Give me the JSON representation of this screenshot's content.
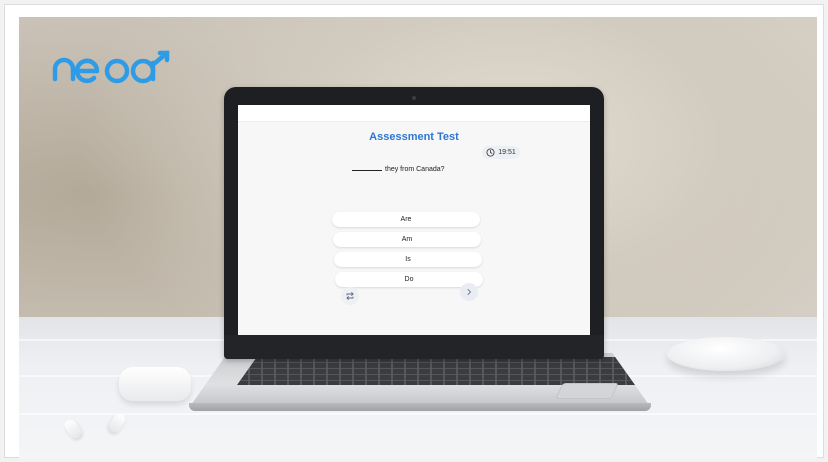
{
  "brand": {
    "logo_text": "neoa",
    "logo_color": "#2e9be6"
  },
  "assessment": {
    "title": "Assessment Test",
    "timer": "19:51",
    "question": "they from Canada?",
    "options": [
      "Are",
      "Am",
      "Is",
      "Do"
    ]
  },
  "icons": {
    "timer": "clock-icon",
    "repeat": "repeat-icon",
    "next": "chevron-right-icon"
  },
  "colors": {
    "title": "#2f76d2"
  }
}
